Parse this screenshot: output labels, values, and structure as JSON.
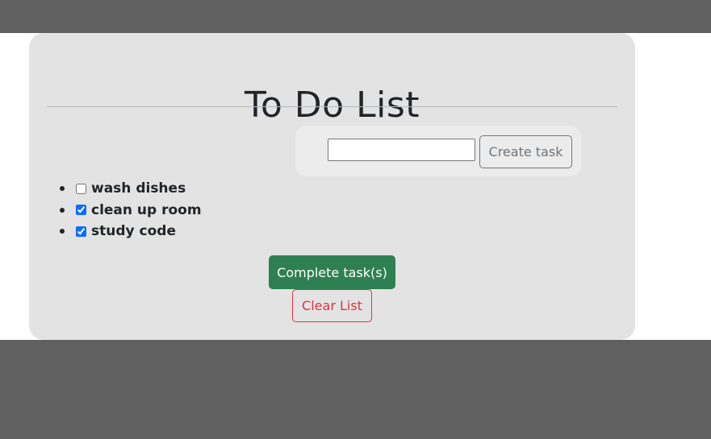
{
  "app": {
    "title": "To Do List"
  },
  "form": {
    "input_value": "",
    "create_label": "Create task"
  },
  "tasks": [
    {
      "label": "wash dishes",
      "checked": false
    },
    {
      "label": "clean up room",
      "checked": true
    },
    {
      "label": "study code",
      "checked": true
    }
  ],
  "actions": {
    "complete_label": "Complete task(s)",
    "clear_label": "Clear List"
  },
  "colors": {
    "complete_button": "#2e8052",
    "clear_button_border": "#dc3545",
    "create_button_border": "#6c757d",
    "card_background": "#e3e3e3",
    "page_background": "#606060"
  }
}
